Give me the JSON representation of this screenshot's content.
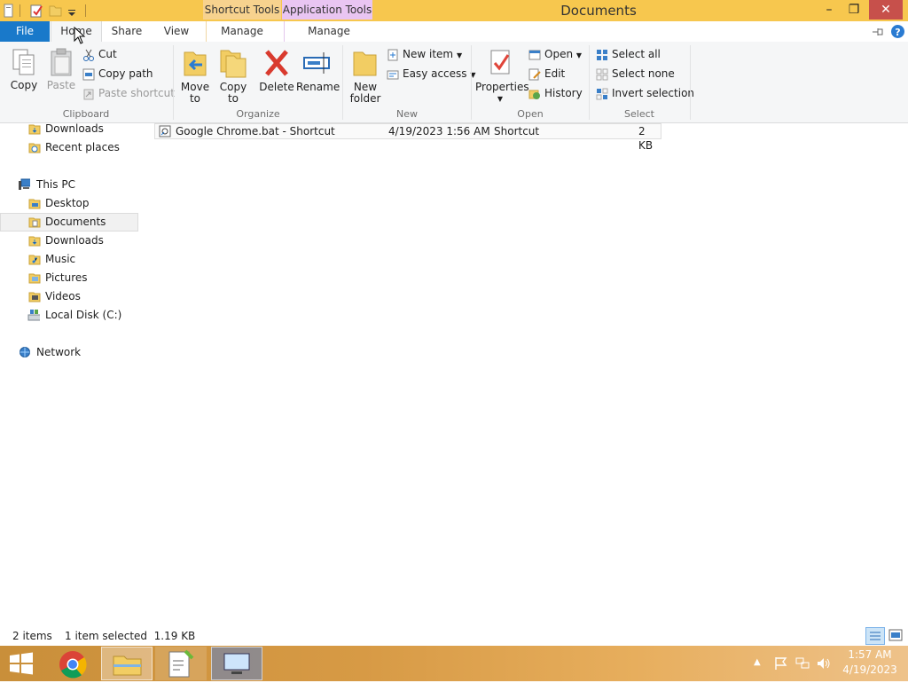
{
  "titlebar": {
    "title": "Documents",
    "context_tabs": {
      "shortcut_tools": "Shortcut Tools",
      "application_tools": "Application Tools"
    },
    "minimize": "–",
    "restore": "❐",
    "close": "✕"
  },
  "tabs": {
    "file": "File",
    "home": "Home",
    "share": "Share",
    "view": "View",
    "manage1": "Manage",
    "manage2": "Manage"
  },
  "ribbon": {
    "clipboard": {
      "label": "Clipboard",
      "copy": "Copy",
      "paste": "Paste",
      "cut": "Cut",
      "copy_path": "Copy path",
      "paste_shortcut": "Paste shortcut"
    },
    "organize": {
      "label": "Organize",
      "move_to": "Move",
      "move_to2": "to",
      "copy_to": "Copy",
      "copy_to2": "to",
      "delete": "Delete",
      "rename": "Rename"
    },
    "new": {
      "label": "New",
      "new_folder": "New",
      "new_folder2": "folder",
      "new_item": "New item",
      "easy_access": "Easy access"
    },
    "open": {
      "label": "Open",
      "properties": "Properties",
      "open": "Open",
      "edit": "Edit",
      "history": "History"
    },
    "select": {
      "label": "Select",
      "select_all": "Select all",
      "select_none": "Select none",
      "invert": "Invert selection"
    }
  },
  "nav": {
    "downloads_fav": "Downloads",
    "recent": "Recent places",
    "this_pc": "This PC",
    "desktop": "Desktop",
    "documents": "Documents",
    "downloads": "Downloads",
    "music": "Music",
    "pictures": "Pictures",
    "videos": "Videos",
    "local_disk": "Local Disk (C:)",
    "network": "Network"
  },
  "files": [
    {
      "name": "Google Chrome.bat - Shortcut",
      "date": "4/19/2023 1:56 AM",
      "type": "Shortcut",
      "size": "2 KB"
    }
  ],
  "status": {
    "items": "2 items",
    "selected": "1 item selected  1.19 KB"
  },
  "taskbar": {
    "time": "1:57 AM",
    "date": "4/19/2023"
  },
  "colors": {
    "accent": "#1979ca",
    "titlebar": "#f7c74e",
    "taskbar": "#d79a45"
  }
}
